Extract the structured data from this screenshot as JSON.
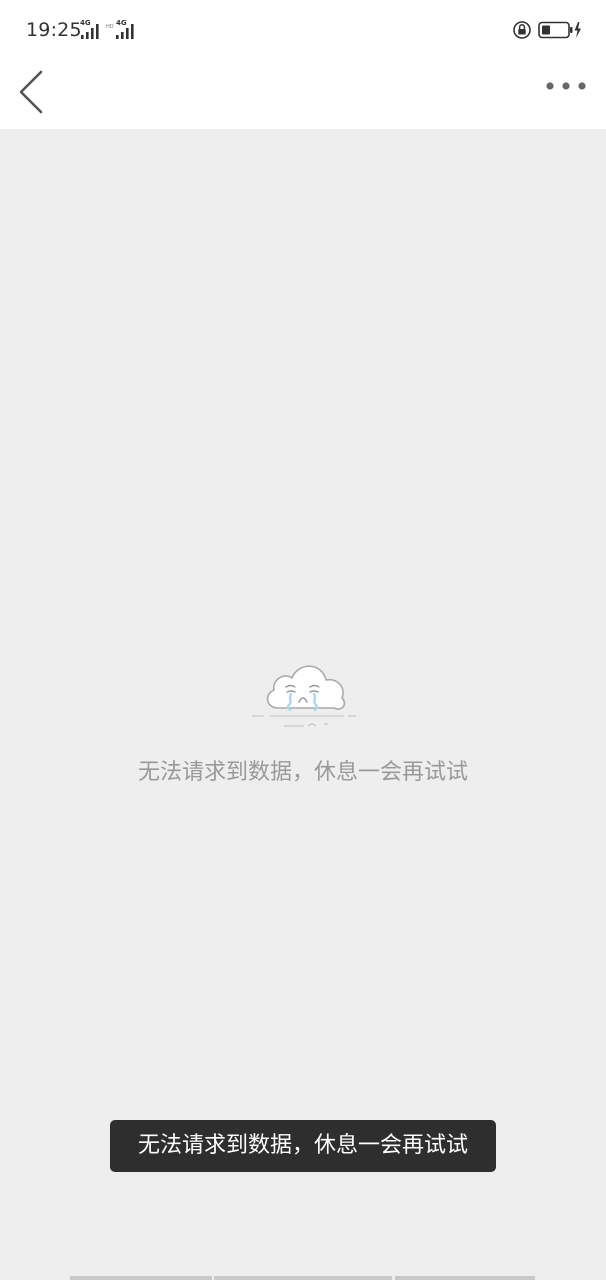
{
  "status_bar": {
    "time": "19:25",
    "network_1": "4G",
    "network_2": "4G",
    "icons": [
      "signal-icon",
      "signal-icon",
      "rotation-lock-icon",
      "battery-charging-icon"
    ]
  },
  "nav": {
    "back_icon": "chevron-left-icon",
    "more_icon": "more-dots-icon"
  },
  "empty_state": {
    "icon": "crying-cloud-icon",
    "message": "无法请求到数据，休息一会再试试"
  },
  "toast": {
    "message": "无法请求到数据，休息一会再试试"
  },
  "colors": {
    "background": "#eeeeee",
    "header": "#ffffff",
    "toast_bg": "#2e2e2e",
    "message_text": "#999999",
    "tears": "#a9d8ef"
  }
}
